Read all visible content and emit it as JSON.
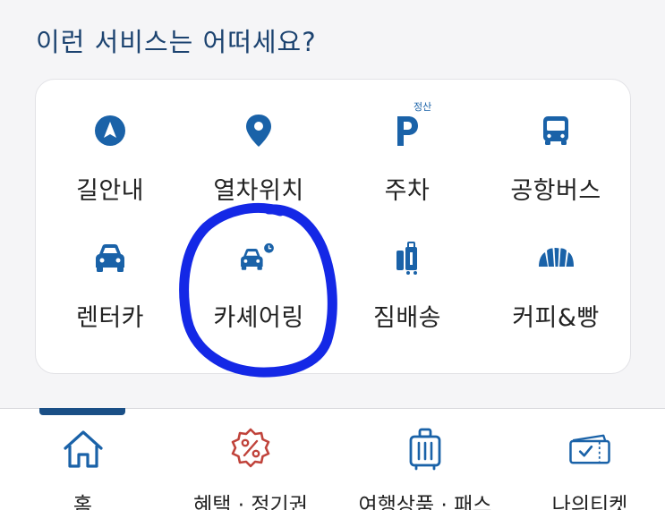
{
  "section": {
    "title": "이런 서비스는 어떠세요?"
  },
  "services": [
    {
      "label": "길안내",
      "icon": "navigation-arrow-icon"
    },
    {
      "label": "열차위치",
      "icon": "location-pin-icon"
    },
    {
      "label": "주차",
      "icon": "parking-icon",
      "badge": "정산"
    },
    {
      "label": "공항버스",
      "icon": "bus-icon"
    },
    {
      "label": "렌터카",
      "icon": "car-icon"
    },
    {
      "label": "카셰어링",
      "icon": "car-clock-icon"
    },
    {
      "label": "짐배송",
      "icon": "luggage-icon"
    },
    {
      "label": "커피&빵",
      "icon": "croissant-icon"
    }
  ],
  "tabs": [
    {
      "label": "홈",
      "icon": "home-icon",
      "active": true
    },
    {
      "label": "혜택 · 정기권",
      "icon": "discount-badge-icon",
      "active": false
    },
    {
      "label": "여행상품 · 패스",
      "icon": "suitcase-icon",
      "active": false
    },
    {
      "label": "나의티켓",
      "icon": "ticket-icon",
      "active": false
    }
  ],
  "colors": {
    "accent": "#1a62a8",
    "title": "#1c4370",
    "discount": "#c0433b",
    "annotation": "#1428e6"
  }
}
